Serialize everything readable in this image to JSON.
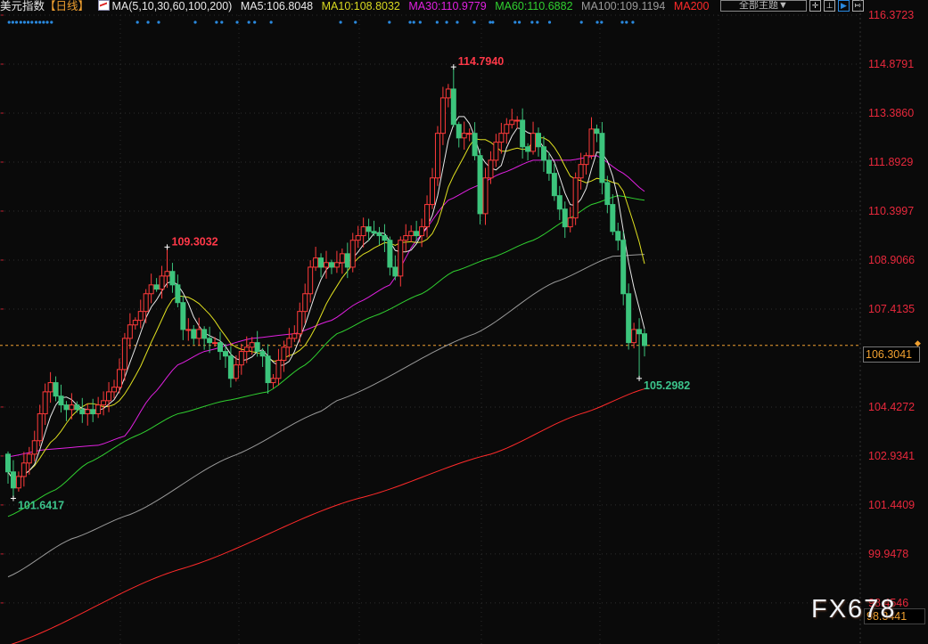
{
  "header": {
    "title": "美元指数",
    "period": "【日线】",
    "ma_params": "MA(5,10,30,60,100,200)",
    "ma5": "MA5:106.8048",
    "ma10": "MA10:108.8032",
    "ma30": "MA30:110.9779",
    "ma60": "MA60:110.6882",
    "ma100": "MA100:109.1194",
    "ma200": "MA200",
    "theme_button": "全部主题▼"
  },
  "toolbar_icons": [
    "crosshair-icon",
    "range-icon",
    "play-icon",
    "expand-icon"
  ],
  "toolbar_glyphs": [
    "✛",
    "⊥",
    "▶",
    "↦"
  ],
  "colors": {
    "up": "#ff3a3a",
    "down": "#3cc47c",
    "ma5": "#e8e8e8",
    "ma10": "#e0e020",
    "ma30": "#e020e0",
    "ma60": "#30d030",
    "ma100": "#9a9a9a",
    "ma200": "#ff2a2a",
    "axis_text": "#e8283c",
    "current_line": "#f0a030",
    "marker": "#2a8ae0"
  },
  "current_price": "106.3041",
  "bottom_box": "98.3441",
  "watermark": "FX678",
  "chart_data": {
    "type": "candlestick",
    "title": "美元指数 日线",
    "ylim": [
      96.67,
      116.84
    ],
    "y_ticks": [
      "116.3723",
      "114.8791",
      "113.3860",
      "111.8929",
      "110.3997",
      "108.9066",
      "107.4135",
      "104.4272",
      "102.9341",
      "101.4409",
      "99.9478",
      "98.4546"
    ],
    "first_open": 102.99,
    "closes": [
      102.45,
      101.96,
      102.31,
      102.72,
      102.99,
      103.4,
      104.22,
      104.89,
      105.17,
      104.76,
      104.49,
      104.35,
      104.49,
      104.35,
      104.22,
      104.35,
      104.22,
      104.49,
      104.62,
      104.89,
      105.03,
      105.57,
      106.52,
      106.93,
      107.07,
      107.34,
      107.88,
      108.15,
      108.02,
      108.42,
      108.56,
      108.15,
      107.61,
      106.79,
      106.79,
      106.52,
      106.79,
      106.52,
      106.39,
      106.39,
      106.12,
      105.98,
      105.3,
      105.71,
      106.12,
      106.25,
      106.39,
      106.12,
      105.98,
      105.17,
      105.3,
      105.85,
      106.25,
      106.52,
      106.66,
      107.34,
      107.88,
      108.69,
      108.97,
      108.69,
      108.83,
      108.69,
      108.83,
      109.1,
      108.69,
      109.51,
      109.65,
      109.92,
      109.78,
      109.73,
      109.65,
      109.51,
      108.69,
      108.42,
      109.51,
      109.65,
      109.78,
      109.65,
      109.92,
      110.6,
      111.41,
      112.77,
      113.85,
      114.12,
      113.04,
      112.63,
      112.77,
      112.77,
      112.09,
      110.32,
      111.41,
      111.95,
      112.5,
      112.77,
      113.04,
      113.17,
      113.17,
      112.36,
      112.22,
      112.77,
      112.36,
      111.95,
      111.55,
      110.87,
      110.46,
      109.92,
      110.19,
      111.41,
      111.82,
      112.09,
      112.9,
      112.77,
      111.27,
      110.6,
      109.78,
      109.51,
      107.88,
      106.39,
      106.79,
      106.66,
      106.3
    ],
    "extremes": [
      {
        "index": 30,
        "high": 109.3032,
        "label": "109.3032",
        "kind": "high"
      },
      {
        "index": 84,
        "high": 114.794,
        "label": "114.7940",
        "kind": "high"
      },
      {
        "index": 1,
        "low": 101.6417,
        "label": "101.6417",
        "kind": "low"
      },
      {
        "index": 119,
        "low": 105.2982,
        "label": "105.2982",
        "kind": "low"
      }
    ],
    "ma_lines": [
      {
        "name": "MA30",
        "knots": [
          [
            0,
            102.91
          ],
          [
            7,
            103.13
          ],
          [
            17,
            103.26
          ],
          [
            22,
            103.54
          ],
          [
            27,
            104.76
          ],
          [
            32,
            105.71
          ],
          [
            37,
            106.12
          ],
          [
            46,
            106.52
          ],
          [
            54,
            106.66
          ],
          [
            61,
            107.07
          ],
          [
            66,
            107.61
          ],
          [
            72,
            108.15
          ],
          [
            77,
            109.51
          ],
          [
            83,
            110.73
          ],
          [
            88,
            111.14
          ],
          [
            93,
            111.55
          ],
          [
            99,
            111.95
          ],
          [
            106,
            111.95
          ],
          [
            111,
            112.09
          ],
          [
            116,
            111.55
          ],
          [
            120,
            111.0
          ]
        ]
      },
      {
        "name": "MA60",
        "knots": [
          [
            0,
            101.09
          ],
          [
            9,
            101.91
          ],
          [
            15,
            102.72
          ],
          [
            24,
            103.54
          ],
          [
            32,
            104.22
          ],
          [
            41,
            104.62
          ],
          [
            49,
            104.89
          ],
          [
            56,
            105.71
          ],
          [
            62,
            106.66
          ],
          [
            69,
            107.2
          ],
          [
            78,
            107.88
          ],
          [
            84,
            108.56
          ],
          [
            91,
            108.97
          ],
          [
            99,
            109.51
          ],
          [
            106,
            110.19
          ],
          [
            110,
            110.6
          ],
          [
            115,
            110.87
          ],
          [
            120,
            110.73
          ]
        ]
      },
      {
        "name": "MA100",
        "knots": [
          [
            0,
            99.25
          ],
          [
            12,
            100.41
          ],
          [
            23,
            101.15
          ],
          [
            42,
            102.91
          ],
          [
            59,
            104.3
          ],
          [
            62,
            104.62
          ],
          [
            88,
            106.66
          ],
          [
            103,
            108.23
          ],
          [
            114,
            109.02
          ],
          [
            120,
            109.08
          ]
        ]
      },
      {
        "name": "MA200",
        "knots": [
          [
            0,
            97.16
          ],
          [
            32,
            99.46
          ],
          [
            66,
            101.64
          ],
          [
            91,
            102.99
          ],
          [
            108,
            104.22
          ],
          [
            120,
            104.98
          ]
        ]
      }
    ],
    "event_markers": [
      0.2,
      0.9,
      1.6,
      2.4,
      3.1,
      3.8,
      4.5,
      5.3,
      6.0,
      6.7,
      7.4,
      8.2,
      24.4,
      26.4,
      28.4,
      35.3,
      39.3,
      40.3,
      43.2,
      45.4,
      46.5,
      49.6,
      62.7,
      65.5,
      71.9,
      75.8,
      76.5,
      77.7,
      80.9,
      82.7,
      84.7,
      87.9,
      87.9,
      90.9,
      91.4,
      95.6,
      96.4,
      98.8,
      99.8,
      102.1,
      108.1,
      111.1,
      111.9,
      115.8,
      116.6,
      117.8
    ]
  }
}
